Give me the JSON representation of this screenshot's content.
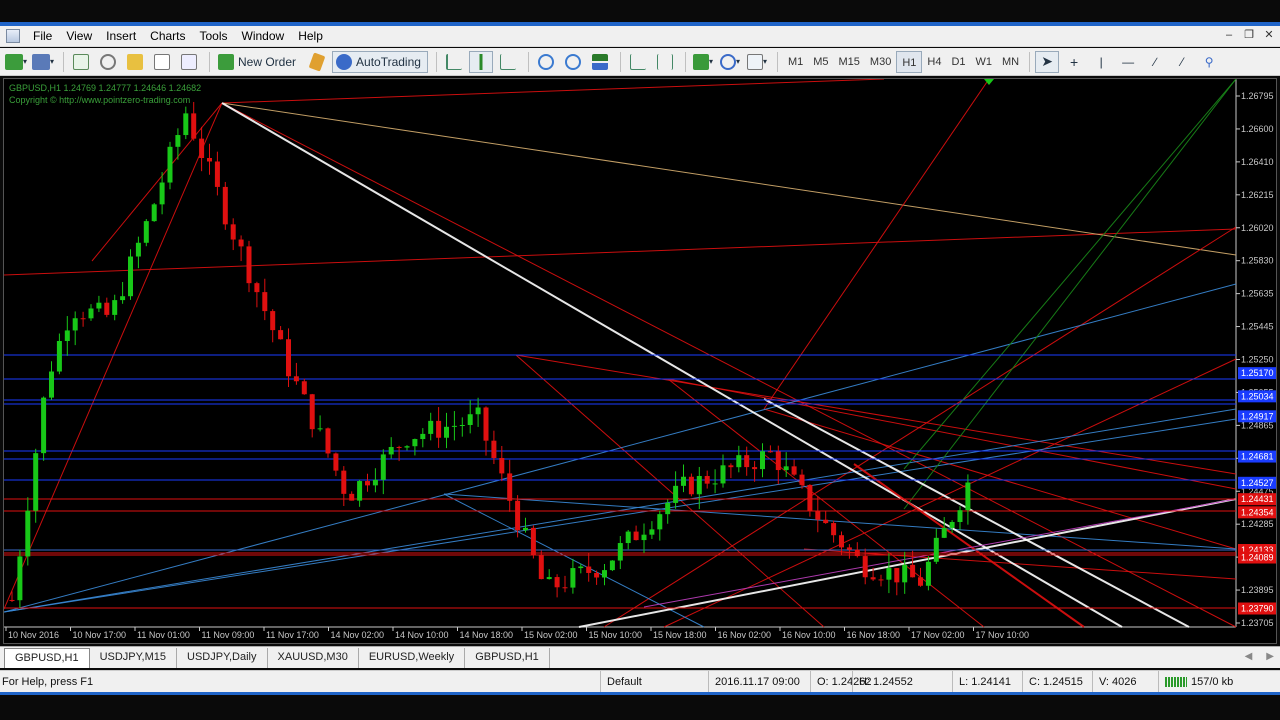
{
  "menu": [
    "File",
    "View",
    "Insert",
    "Charts",
    "Tools",
    "Window",
    "Help"
  ],
  "toolbar": {
    "new_order": "New Order",
    "autotrading": "AutoTrading",
    "timeframes": [
      "M1",
      "M5",
      "M15",
      "M30",
      "H1",
      "H4",
      "D1",
      "W1",
      "MN"
    ],
    "active_timeframe": "H1"
  },
  "chart": {
    "symbol_line": "GBPUSD,H1  1.24769 1.24777 1.24646 1.24682",
    "copyright": "Copyright © http://www.pointzero-trading.com",
    "price_labels": [
      "1.26795",
      "1.26600",
      "1.26410",
      "1.26215",
      "1.26020",
      "1.25830",
      "1.25635",
      "1.25445",
      "1.25250",
      "1.25055",
      "1.24865",
      "1.24670",
      "1.24475",
      "1.24285",
      "1.24090",
      "1.23895",
      "1.23705"
    ],
    "highlight_labels": [
      {
        "text": "1.25170",
        "bg": "#1a3cff"
      },
      {
        "text": "1.25034",
        "bg": "#1a3cff"
      },
      {
        "text": "1.24917",
        "bg": "#1a3cff"
      },
      {
        "text": "1.24681",
        "bg": "#1a3cff"
      },
      {
        "text": "1.24527",
        "bg": "#1a3cff"
      },
      {
        "text": "1.24431",
        "bg": "#e01010"
      },
      {
        "text": "1.24354",
        "bg": "#e01010"
      },
      {
        "text": "1.24133",
        "bg": "#e01010"
      },
      {
        "text": "1.24089",
        "bg": "#e01010"
      },
      {
        "text": "1.23790",
        "bg": "#e01010"
      }
    ],
    "time_labels": [
      "10 Nov 2016",
      "10 Nov 17:00",
      "11 Nov 01:00",
      "11 Nov 09:00",
      "11 Nov 17:00",
      "14 Nov 02:00",
      "14 Nov 10:00",
      "14 Nov 18:00",
      "15 Nov 02:00",
      "15 Nov 10:00",
      "15 Nov 18:00",
      "16 Nov 02:00",
      "16 Nov 10:00",
      "16 Nov 18:00",
      "17 Nov 02:00",
      "17 Nov 10:00"
    ],
    "colors": {
      "bull": "#18c818",
      "bear": "#e01010",
      "bg": "#000000",
      "axis": "#c8c8c8"
    }
  },
  "tabs": [
    "GBPUSD,H1",
    "USDJPY,M15",
    "USDJPY,Daily",
    "XAUUSD,M30",
    "EURUSD,Weekly",
    "GBPUSD,H1"
  ],
  "active_tab": 0,
  "status": {
    "help": "For Help, press F1",
    "profile": "Default",
    "datetime": "2016.11.17 09:00",
    "open": "O: 1.24262",
    "high": "H: 1.24552",
    "low": "L: 1.24141",
    "close": "C: 1.24515",
    "volume": "V: 4026",
    "traffic": "157/0 kb"
  }
}
